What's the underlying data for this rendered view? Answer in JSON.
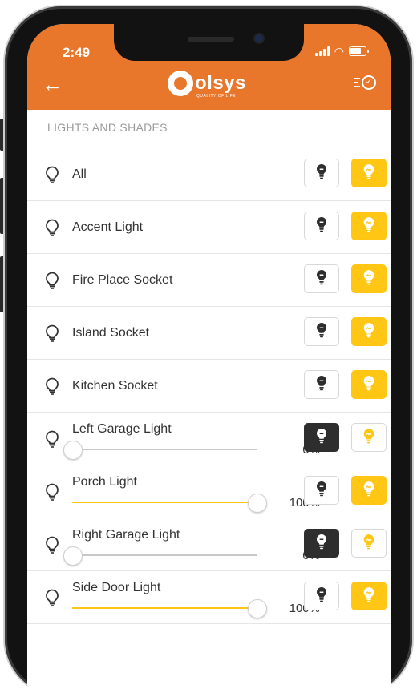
{
  "status_bar": {
    "time": "2:49"
  },
  "header": {
    "logo_text": "olsys",
    "logo_subtext": "QUALITY OF LIFE",
    "brand_color": "#e8772c"
  },
  "section": {
    "title": "LIGHTS AND SHADES"
  },
  "colors": {
    "on_active": "#ffc613",
    "off_active": "#2e2e2e"
  },
  "lights": [
    {
      "name": "All",
      "type": "switch",
      "state": "on"
    },
    {
      "name": "Accent Light",
      "type": "switch",
      "state": "on"
    },
    {
      "name": "Fire Place Socket",
      "type": "switch",
      "state": "on"
    },
    {
      "name": "Island Socket",
      "type": "switch",
      "state": "on"
    },
    {
      "name": "Kitchen Socket",
      "type": "switch",
      "state": "on"
    },
    {
      "name": "Left Garage Light",
      "type": "dimmer",
      "state": "off",
      "level": 0,
      "level_text": "0%"
    },
    {
      "name": "Porch Light",
      "type": "dimmer",
      "state": "on",
      "level": 100,
      "level_text": "100%"
    },
    {
      "name": "Right Garage Light",
      "type": "dimmer",
      "state": "off",
      "level": 0,
      "level_text": "0%"
    },
    {
      "name": "Side Door Light",
      "type": "dimmer",
      "state": "on",
      "level": 100,
      "level_text": "100%"
    }
  ]
}
